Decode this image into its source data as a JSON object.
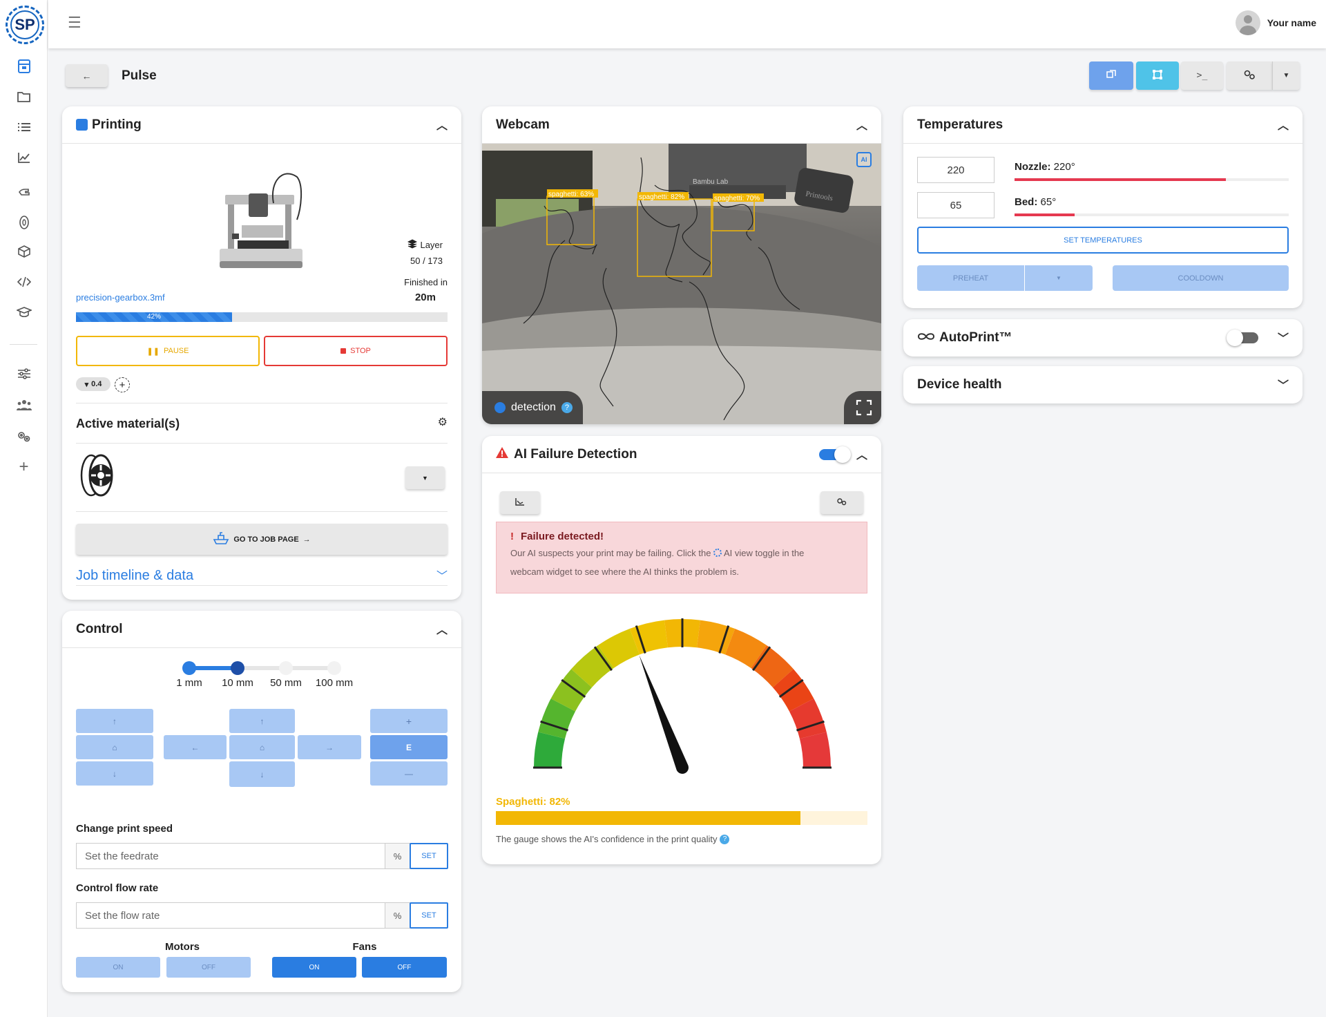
{
  "sidebar": {
    "logo_text": "SP",
    "items": [
      {
        "icon": "printer-icon"
      },
      {
        "icon": "folder-icon"
      },
      {
        "icon": "list-icon"
      },
      {
        "icon": "chart-icon"
      },
      {
        "icon": "hand-icon"
      },
      {
        "icon": "filament-icon"
      },
      {
        "icon": "cube-icon"
      },
      {
        "icon": "code-icon"
      },
      {
        "icon": "graduation-icon"
      },
      {
        "icon": "sliders-icon"
      },
      {
        "icon": "users-icon"
      },
      {
        "icon": "gears-icon"
      },
      {
        "icon": "plus-icon"
      }
    ]
  },
  "topbar": {
    "user_name": "Your name"
  },
  "page": {
    "title": "Pulse",
    "back_label": "←"
  },
  "colors": {
    "primary": "#2a7de1",
    "danger": "#e53935",
    "warning": "#f2b705",
    "alert_bg": "#f8d7da"
  },
  "printing": {
    "title": "Printing",
    "layer_label": "Layer",
    "layer_value": "50 / 173",
    "finished_label": "Finished in",
    "finished_value": "20m",
    "filename": "precision-gearbox.3mf",
    "progress_percent": 42,
    "progress_label": "42%",
    "pause_label": "PAUSE",
    "stop_label": "STOP",
    "nozzle_badge": "0.4",
    "materials_title": "Active material(s)",
    "go_to_job_label": "GO TO JOB PAGE",
    "timeline_label": "Job timeline & data"
  },
  "control": {
    "title": "Control",
    "steps": [
      "1 mm",
      "10 mm",
      "50 mm",
      "100 mm"
    ],
    "selected_step_index": 1,
    "extruder_label": "E",
    "plus_label": "+",
    "minus_label": "—",
    "speed_title": "Change print speed",
    "speed_placeholder": "Set the feedrate",
    "flow_title": "Control flow rate",
    "flow_placeholder": "Set the flow rate",
    "percent_label": "%",
    "set_label": "SET",
    "motors_title": "Motors",
    "fans_title": "Fans",
    "on_label": "ON",
    "off_label": "OFF"
  },
  "webcam": {
    "title": "Webcam",
    "detection_label": "detection",
    "detections": [
      {
        "label": "spaghetti: 63%"
      },
      {
        "label": "spaghetti: 82%"
      },
      {
        "label": "spaghetti: 70%"
      }
    ],
    "ai_badge": "AI",
    "scene_text_1": "Bambu Lab",
    "scene_text_2": "Printools"
  },
  "ai": {
    "title": "AI Failure Detection",
    "enabled": true,
    "alert_title": "Failure detected!",
    "alert_text_1": "Our AI suspects your print may be failing. Click the",
    "alert_text_2": "AI view toggle in the",
    "alert_text_3": "webcam widget to see where the AI thinks the problem is.",
    "confidence_label": "Spaghetti: 82%",
    "confidence_value": 82,
    "caption": "The gauge shows the AI's confidence in the print quality"
  },
  "temperatures": {
    "title": "Temperatures",
    "nozzle_input": "220",
    "bed_input": "65",
    "nozzle_label": "Nozzle:",
    "nozzle_value": "220°",
    "nozzle_fraction": 0.77,
    "bed_label": "Bed:",
    "bed_value": "65°",
    "bed_fraction": 0.22,
    "set_label": "SET TEMPERATURES",
    "preheat_label": "PREHEAT",
    "cooldown_label": "COOLDOWN"
  },
  "autoprint": {
    "title": "AutoPrint™",
    "enabled": false
  },
  "device_health": {
    "title": "Device health"
  }
}
